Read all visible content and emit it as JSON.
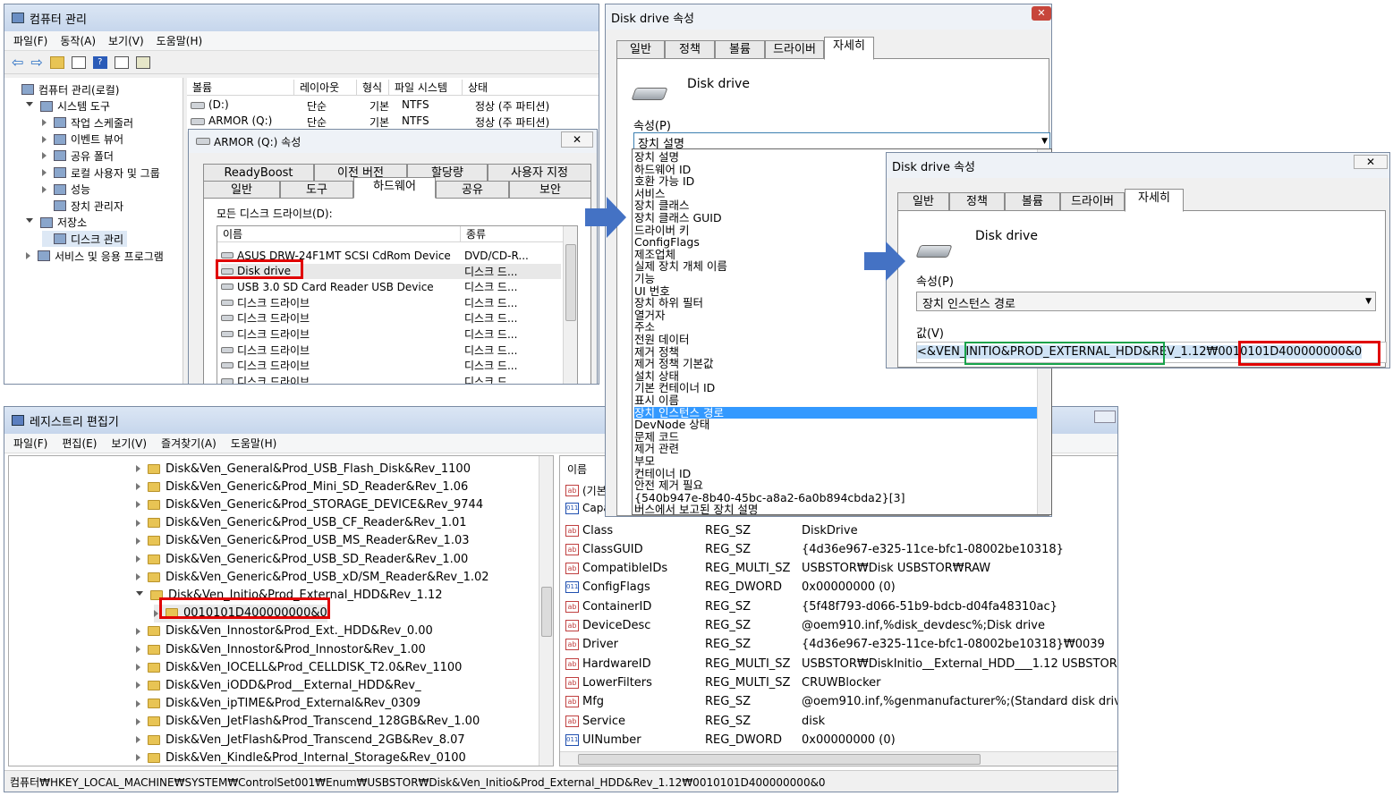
{
  "cm": {
    "title": "컴퓨터 관리",
    "menu": [
      "파일(F)",
      "동작(A)",
      "보기(V)",
      "도움말(H)"
    ],
    "tree": [
      {
        "label": "컴퓨터 관리(로컬)",
        "lvl": 0,
        "exp": "none"
      },
      {
        "label": "시스템 도구",
        "lvl": 1,
        "exp": "open"
      },
      {
        "label": "작업 스케줄러",
        "lvl": 2,
        "exp": "closed"
      },
      {
        "label": "이벤트 뷰어",
        "lvl": 2,
        "exp": "closed"
      },
      {
        "label": "공유 폴더",
        "lvl": 2,
        "exp": "closed"
      },
      {
        "label": "로컬 사용자 및 그룹",
        "lvl": 2,
        "exp": "closed"
      },
      {
        "label": "성능",
        "lvl": 2,
        "exp": "closed"
      },
      {
        "label": "장치 관리자",
        "lvl": 2,
        "exp": "none"
      },
      {
        "label": "저장소",
        "lvl": 1,
        "exp": "open"
      },
      {
        "label": "디스크 관리",
        "lvl": 2,
        "exp": "none",
        "sel": true
      },
      {
        "label": "서비스 및 응용 프로그램",
        "lvl": 1,
        "exp": "closed"
      }
    ],
    "vol_headers": [
      "볼륨",
      "레이아웃",
      "형식",
      "파일 시스템",
      "상태"
    ],
    "vols": [
      [
        "(D:)",
        "단순",
        "기본",
        "NTFS",
        "정상 (주 파티션)"
      ],
      [
        "ARMOR (Q:)",
        "단순",
        "기본",
        "NTFS",
        "정상 (주 파티션)"
      ]
    ]
  },
  "armor": {
    "title": "ARMOR (Q:) 속성",
    "tabs_top": [
      "ReadyBoost",
      "이전 버전",
      "할당량",
      "사용자 지정"
    ],
    "tabs_bottom": [
      "일반",
      "도구",
      "하드웨어",
      "공유",
      "보안"
    ],
    "label": "모든 디스크 드라이브(D):",
    "headers": [
      "이름",
      "종류"
    ],
    "rows": [
      [
        "ASUS DRW-24F1MT SCSI CdRom Device",
        "DVD/CD-R..."
      ],
      [
        "Disk drive",
        "디스크 드..."
      ],
      [
        "USB 3.0  SD Card Reader USB Device",
        "디스크 드..."
      ],
      [
        "디스크 드라이브",
        "디스크 드..."
      ],
      [
        "디스크 드라이브",
        "디스크 드..."
      ],
      [
        "디스크 드라이브",
        "디스크 드..."
      ],
      [
        "디스크 드라이브",
        "디스크 드..."
      ],
      [
        "디스크 드라이브",
        "디스크 드..."
      ],
      [
        "디스크 드라이브",
        "디스크 드..."
      ]
    ]
  },
  "dd1": {
    "title": "Disk drive 속성",
    "tabs": [
      "일반",
      "정책",
      "볼륨",
      "드라이버",
      "자세히"
    ],
    "device": "Disk drive",
    "prop_label": "속성(P)",
    "selected": "장치 설명",
    "options": [
      "장치 설명",
      "하드웨어 ID",
      "호환 가능 ID",
      "서비스",
      "장치 클래스",
      "장치 클래스 GUID",
      "드라이버 키",
      "ConfigFlags",
      "제조업체",
      "실제 장치 개체 이름",
      "기능",
      "UI 번호",
      "장치 하위 필터",
      "열거자",
      "주소",
      "전원 데이터",
      "제거 정책",
      "제거 정책 기본값",
      "설치 상태",
      "기본 컨테이너 ID",
      "표시 이름",
      "장치 인스턴스 경로",
      "DevNode 상태",
      "문제 코드",
      "제거 관련",
      "부모",
      "컨테이너 ID",
      "안전 제거 필요",
      "{540b947e-8b40-45bc-a8a2-6a0b894cbda2}[3]",
      "버스에서 보고된 장치 설명"
    ],
    "highlight": 21
  },
  "dd2": {
    "title": "Disk drive 속성",
    "tabs": [
      "일반",
      "정책",
      "볼륨",
      "드라이버",
      "자세히"
    ],
    "device": "Disk drive",
    "prop_label": "속성(P)",
    "selected": "장치 인스턴스 경로",
    "value_label": "값(V)",
    "v1": "<&VEN_",
    "v2": "INITIO&PROD_EXTERNAL_HDD",
    "v3": "&REV_1.12₩",
    "v4": "0010101D400000000&0"
  },
  "reg": {
    "title": "레지스트리 편집기",
    "menu": [
      "파일(F)",
      "편집(E)",
      "보기(V)",
      "즐겨찾기(A)",
      "도움말(H)"
    ],
    "keys": [
      {
        "label": "Disk&Ven_General&Prod_USB_Flash_Disk&Rev_1100"
      },
      {
        "label": "Disk&Ven_Generic&Prod_Mini_SD_Reader&Rev_1.06"
      },
      {
        "label": "Disk&Ven_Generic&Prod_STORAGE_DEVICE&Rev_9744"
      },
      {
        "label": "Disk&Ven_Generic&Prod_USB_CF_Reader&Rev_1.01"
      },
      {
        "label": "Disk&Ven_Generic&Prod_USB_MS_Reader&Rev_1.03"
      },
      {
        "label": "Disk&Ven_Generic&Prod_USB_SD_Reader&Rev_1.00"
      },
      {
        "label": "Disk&Ven_Generic&Prod_USB_xD/SM_Reader&Rev_1.02"
      },
      {
        "label": "Disk&Ven_Initio&Prod_External_HDD&Rev_1.12",
        "open": true
      },
      {
        "label": "0010101D400000000&0",
        "child": true
      },
      {
        "label": "Disk&Ven_Innostor&Prod_Ext._HDD&Rev_0.00"
      },
      {
        "label": "Disk&Ven_Innostor&Prod_Innostor&Rev_1.00"
      },
      {
        "label": "Disk&Ven_IOCELL&Prod_CELLDISK_T2.0&Rev_1100"
      },
      {
        "label": "Disk&Ven_iODD&Prod__External_HDD&Rev_"
      },
      {
        "label": "Disk&Ven_ipTIME&Prod_External&Rev_0309"
      },
      {
        "label": "Disk&Ven_JetFlash&Prod_Transcend_128GB&Rev_1.00"
      },
      {
        "label": "Disk&Ven_JetFlash&Prod_Transcend_2GB&Rev_8.07"
      },
      {
        "label": "Disk&Ven_Kindle&Prod_Internal_Storage&Rev_0100"
      }
    ],
    "name_header": "이름",
    "partial": [
      "(기본",
      "Capa"
    ],
    "values": [
      [
        "ab",
        "Class",
        "REG_SZ",
        "DiskDrive"
      ],
      [
        "ab",
        "ClassGUID",
        "REG_SZ",
        "{4d36e967-e325-11ce-bfc1-08002be10318}"
      ],
      [
        "ab",
        "CompatibleIDs",
        "REG_MULTI_SZ",
        "USBSTOR₩Disk USBSTOR₩RAW"
      ],
      [
        "bin",
        "ConfigFlags",
        "REG_DWORD",
        "0x00000000 (0)"
      ],
      [
        "ab",
        "ContainerID",
        "REG_SZ",
        "{5f48f793-d066-51b9-bdcb-d04fa48310ac}"
      ],
      [
        "ab",
        "DeviceDesc",
        "REG_SZ",
        "@oem910.inf,%disk_devdesc%;Disk drive"
      ],
      [
        "ab",
        "Driver",
        "REG_SZ",
        "{4d36e967-e325-11ce-bfc1-08002be10318}₩0039"
      ],
      [
        "ab",
        "HardwareID",
        "REG_MULTI_SZ",
        "USBSTOR₩DiskInitio__External_HDD___1.12 USBSTOR₩Dis"
      ],
      [
        "ab",
        "LowerFilters",
        "REG_MULTI_SZ",
        "CRUWBlocker"
      ],
      [
        "ab",
        "Mfg",
        "REG_SZ",
        "@oem910.inf,%genmanufacturer%;(Standard disk drives)"
      ],
      [
        "ab",
        "Service",
        "REG_SZ",
        "disk"
      ],
      [
        "bin",
        "UINumber",
        "REG_DWORD",
        "0x00000000 (0)"
      ]
    ],
    "status": "컴퓨터₩HKEY_LOCAL_MACHINE₩SYSTEM₩ControlSet001₩Enum₩USBSTOR₩Disk&Ven_Initio&Prod_External_HDD&Rev_1.12₩0010101D400000000&0"
  }
}
